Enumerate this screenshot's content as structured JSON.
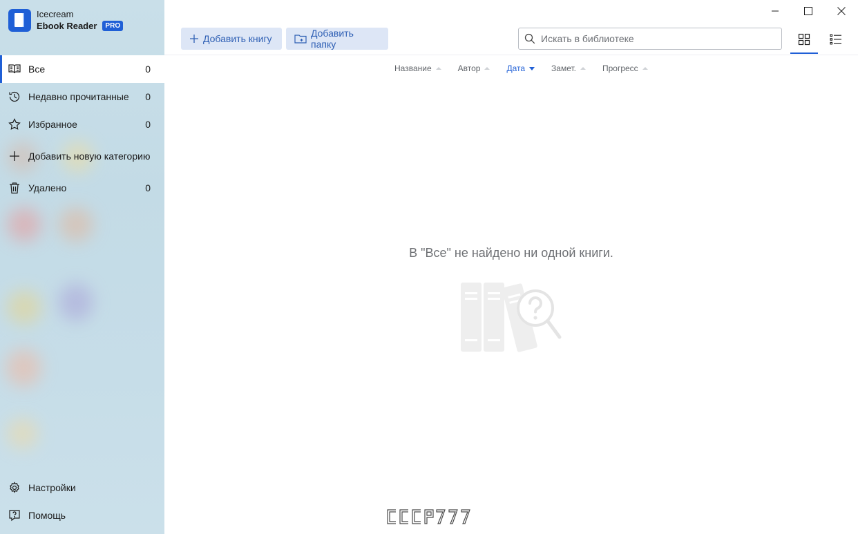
{
  "app": {
    "brand_line1": "Icecream",
    "brand_line2": "Ebook Reader",
    "badge": "PRO"
  },
  "sidebar": {
    "items": [
      {
        "label": "Все",
        "count": "0",
        "icon": "book-open-icon"
      },
      {
        "label": "Недавно прочитанные",
        "count": "0",
        "icon": "history-icon"
      },
      {
        "label": "Избранное",
        "count": "0",
        "icon": "star-icon"
      },
      {
        "label": "Добавить новую категорию",
        "icon": "plus-icon"
      },
      {
        "label": "Удалено",
        "count": "0",
        "icon": "trash-icon"
      }
    ],
    "bottom": [
      {
        "label": "Настройки",
        "icon": "gear-icon"
      },
      {
        "label": "Помощь",
        "icon": "help-icon"
      }
    ]
  },
  "toolbar": {
    "add_book": "Добавить книгу",
    "add_folder": "Добавить папку",
    "search_placeholder": "Искать в библиотеке"
  },
  "sort": {
    "columns": [
      "Название",
      "Автор",
      "Дата",
      "Замет.",
      "Прогресс"
    ],
    "active": "Дата"
  },
  "main": {
    "empty_message": "В \"Все\" не найдено ни одной книги."
  },
  "watermark": "CCCP777",
  "colors": {
    "accent": "#1f5fd6",
    "toolbar_button_bg": "#dde6f6",
    "sidebar_bg": "#c6dde8"
  }
}
